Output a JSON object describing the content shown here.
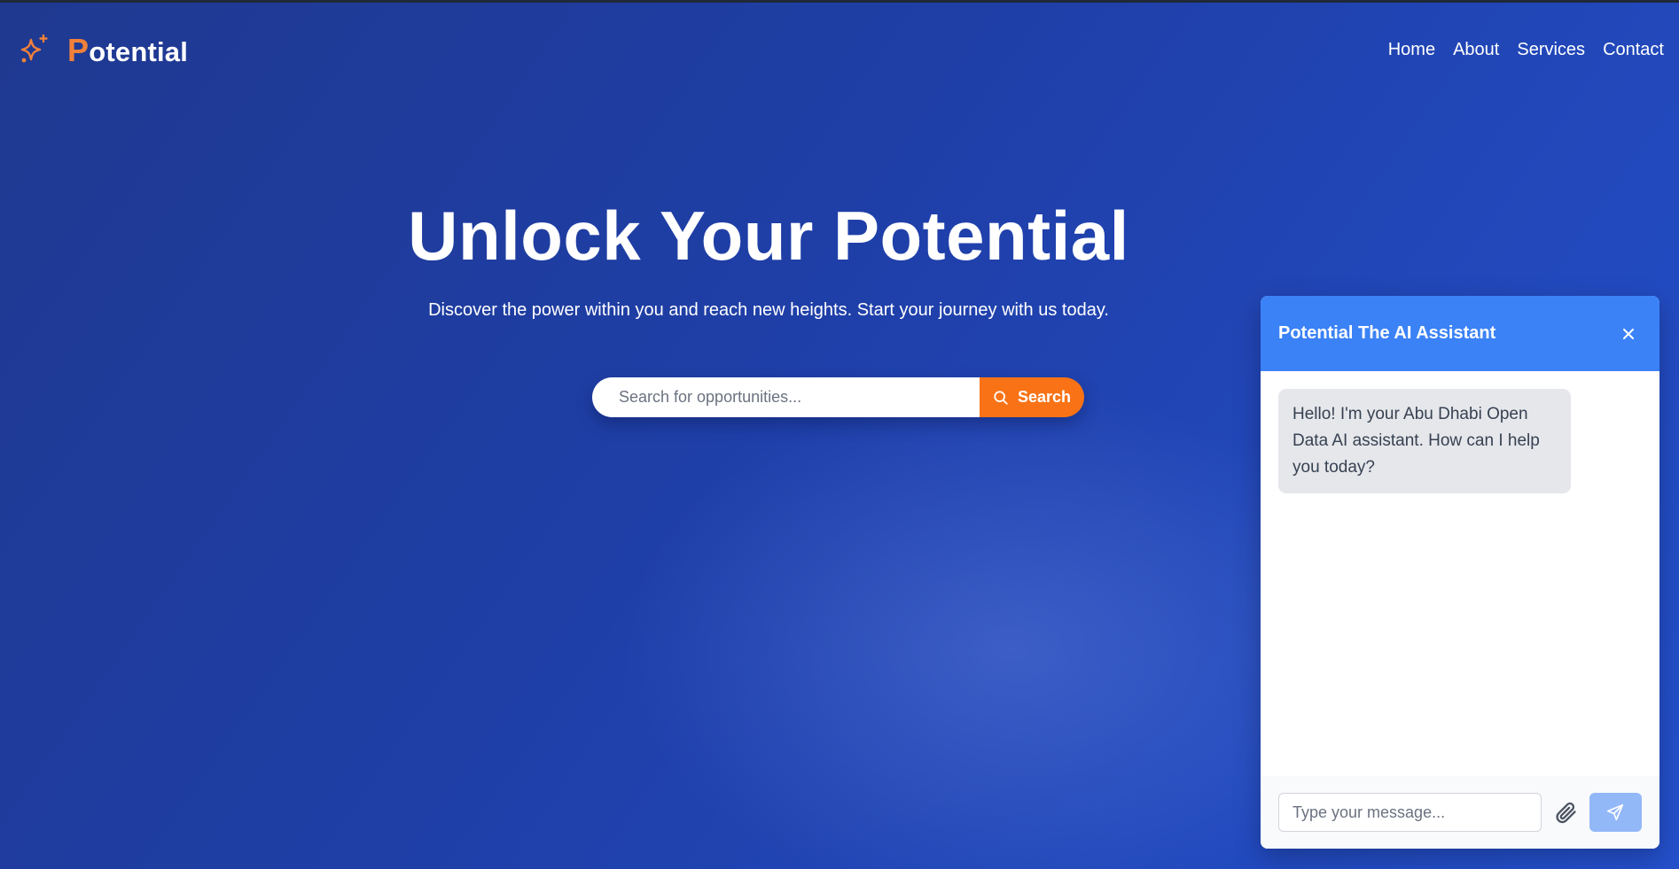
{
  "header": {
    "logo_initial": "P",
    "logo_rest": "otential",
    "nav": [
      {
        "label": "Home"
      },
      {
        "label": "About"
      },
      {
        "label": "Services"
      },
      {
        "label": "Contact"
      }
    ]
  },
  "hero": {
    "title": "Unlock Your Potential",
    "subtitle": "Discover the power within you and reach new heights. Start your journey with us today."
  },
  "search": {
    "placeholder": "Search for opportunities...",
    "button_label": "Search"
  },
  "chat": {
    "title": "Potential The AI Assistant",
    "messages": [
      {
        "sender": "assistant",
        "text": "Hello! I'm your Abu Dhabi Open Data AI assistant. How can I help you today?"
      }
    ],
    "input_placeholder": "Type your message..."
  },
  "colors": {
    "accent": "#f97316",
    "chat_header": "#3b82f6",
    "background": "#1f3fa8"
  },
  "icons": {
    "logo": "sparkles-icon",
    "search": "search-icon",
    "close": "close-icon",
    "attach": "paperclip-icon",
    "send": "send-icon"
  }
}
